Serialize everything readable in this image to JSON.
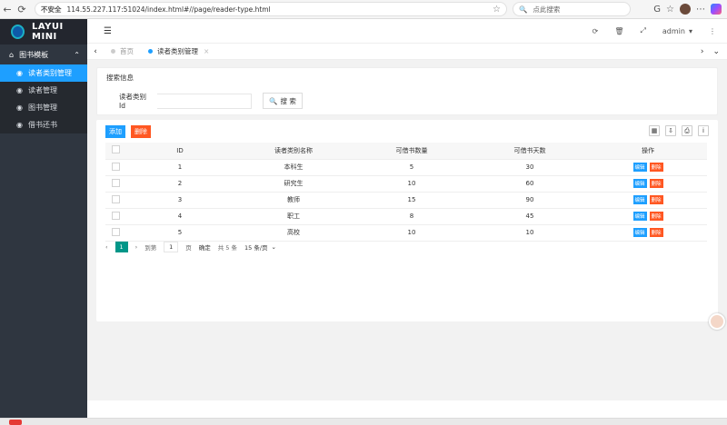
{
  "browser": {
    "security": "不安全",
    "url": "114.55.227.117:51024/index.html#//page/reader-type.html",
    "search_placeholder": "点此搜索"
  },
  "sidebar": {
    "logo": "LAYUI MINI",
    "group": "图书模板",
    "items": [
      {
        "label": "读者类别管理",
        "active": true
      },
      {
        "label": "读者管理"
      },
      {
        "label": "图书管理"
      },
      {
        "label": "借书还书"
      }
    ]
  },
  "header": {
    "user": "admin"
  },
  "tabs": [
    {
      "label": "首页"
    },
    {
      "label": "读者类别管理",
      "active": true
    }
  ],
  "search": {
    "title": "搜索信息",
    "field_label": "读者类别Id",
    "button": "搜 索"
  },
  "toolbar": {
    "add": "添加",
    "delete": "删除"
  },
  "table": {
    "headers": [
      "ID",
      "读者类别名称",
      "可借书数量",
      "可借书天数",
      "操作"
    ],
    "rows": [
      {
        "id": "1",
        "name": "本科生",
        "count": "5",
        "days": "30"
      },
      {
        "id": "2",
        "name": "研究生",
        "count": "10",
        "days": "60"
      },
      {
        "id": "3",
        "name": "教师",
        "count": "15",
        "days": "90"
      },
      {
        "id": "4",
        "name": "职工",
        "count": "8",
        "days": "45"
      },
      {
        "id": "5",
        "name": "高校",
        "count": "10",
        "days": "10"
      }
    ],
    "edit": "编辑",
    "del": "删除"
  },
  "pager": {
    "current": "1",
    "goto": "到第",
    "page_input": "1",
    "page_unit": "页",
    "ok": "确定",
    "total": "共 5 条",
    "size": "15 条/页"
  }
}
